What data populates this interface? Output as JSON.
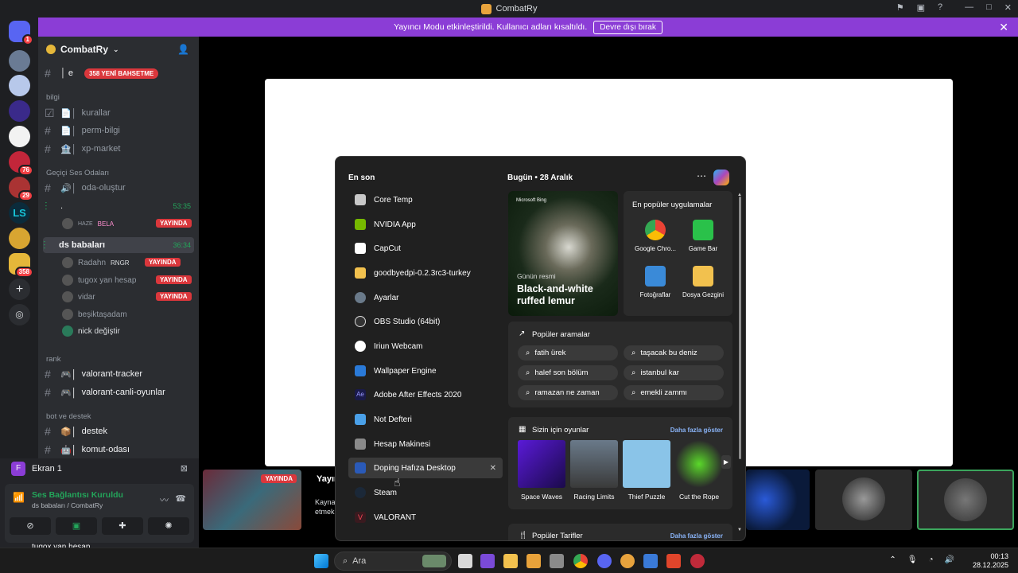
{
  "window": {
    "title": "CombatRy"
  },
  "banner": {
    "text": "Yayıncı Modu etkinleştirildi. Kullanıcı adları kısaltıldı.",
    "button": "Devre dışı bırak"
  },
  "servers": {
    "badges": [
      "1",
      "76",
      "29",
      "358"
    ]
  },
  "guild": {
    "name": "CombatRy",
    "new_mentions": "358 YENİ BAHSETME"
  },
  "channels": {
    "cat_bilgi": "bilgi",
    "kurallar": "kurallar",
    "perm_bilgi": "perm-bilgi",
    "xp_market": "xp-market",
    "cat_voice": "Geçiçi Ses Odaları",
    "oda_olustur": "oda-oluştur",
    "voice1_name": ".",
    "voice1_time": "53:35",
    "voice1_user1": "HAZE",
    "voice1_user2": "BELA",
    "live": "YAYINDA",
    "voice2_name": "ds babaları",
    "voice2_time": "36:34",
    "v2_users": [
      "Radahn",
      "tugox yan hesap",
      "vidar",
      "beşiktaşadam",
      "nick değiştir"
    ],
    "v2_user1_tag": "RNGR",
    "cat_rank": "rank",
    "valorant_tracker": "valorant-tracker",
    "valorant_canli": "valorant-canli-oyunlar",
    "cat_bot": "bot ve destek",
    "destek": "destek",
    "komut": "komut-odası"
  },
  "screen": {
    "label": "Ekran 1"
  },
  "voice": {
    "status": "Ses Bağlantısı Kuruldu",
    "location": "ds babaları / CombatRy",
    "user": "tugox yan hesap"
  },
  "thumb": {
    "live": "YAYINDA",
    "title": "Yayın",
    "line1": "Kayna",
    "line2": "etmek"
  },
  "start": {
    "recent_header": "En son",
    "today_header": "Bugün • 28 Aralık",
    "apps": [
      "Core Temp",
      "NVIDIA App",
      "CapCut",
      "goodbyedpi-0.2.3rc3-turkey",
      "Ayarlar",
      "OBS Studio (64bit)",
      "Iriun Webcam",
      "Wallpaper Engine",
      "Adobe After Effects 2020",
      "Not Defteri",
      "Hesap Makinesi",
      "Doping Hafıza Desktop",
      "Steam",
      "VALORANT"
    ],
    "bing_brand": "Microsoft Bing",
    "photo_tag": "Günün resmi",
    "photo_title": "Black-and-white ruffed lemur",
    "popular_apps_title": "En popüler uygulamalar",
    "popular_apps": [
      "Google Chro...",
      "Game Bar",
      "Fotoğraflar",
      "Dosya Gezgini"
    ],
    "popular_searches_title": "Popüler aramalar",
    "searches": [
      "fatih ürek",
      "taşacak bu deniz",
      "halef son bölüm",
      "istanbul kar",
      "ramazan ne zaman",
      "emekli zammı"
    ],
    "games_title": "Sizin için oyunlar",
    "more": "Daha fazla göster",
    "games": [
      "Space Waves",
      "Racing Limits",
      "Thief Puzzle",
      "Cut the Rope"
    ],
    "recipes_title": "Popüler Tarifler"
  },
  "taskbar": {
    "search_placeholder": "Ara",
    "time": "00:13",
    "date": "28.12.2025"
  }
}
